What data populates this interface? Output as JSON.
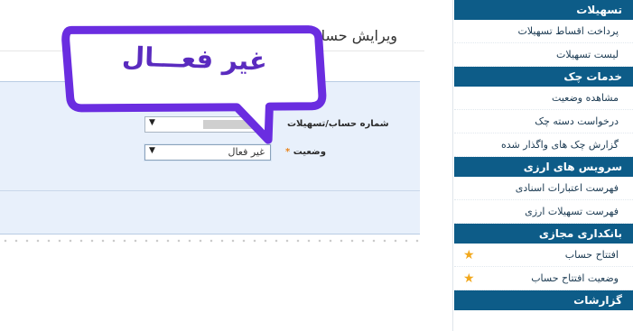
{
  "sidebar": {
    "sections": [
      {
        "header": "تسهیلات",
        "items": [
          {
            "label": "پرداخت اقساط تسهیلات"
          },
          {
            "label": "لیست تسهیلات"
          }
        ]
      },
      {
        "header": "خدمات چک",
        "items": [
          {
            "label": "مشاهده وضعیت"
          },
          {
            "label": "درخواست دسته چک"
          },
          {
            "label": "گزارش چک های واگذار شده"
          }
        ]
      },
      {
        "header": "سرویس های ارزی",
        "items": [
          {
            "label": "فهرست اعتبارات اسنادی"
          },
          {
            "label": "فهرست تسهیلات ارزی"
          }
        ]
      },
      {
        "header": "بانکداری مجازی",
        "items": [
          {
            "label": "افتتاح حساب",
            "starred": true
          },
          {
            "label": "وضعیت افتتاح حساب",
            "starred": true
          }
        ]
      },
      {
        "header": "گزارشات",
        "items": []
      }
    ]
  },
  "main": {
    "title": "ویرایش حسا",
    "form": {
      "label_top_fragment": "ش",
      "account_label": "شماره حساب/تسهیلات",
      "status_label": "وضعیت",
      "status_value": "غیر فعال"
    }
  },
  "callout": {
    "text": "غیر فعـــال"
  },
  "colors": {
    "sidebar_header_bg": "#0d5c88",
    "callout_border": "#6a2de0",
    "star": "#f2a81d",
    "required_star": "#e8841c"
  }
}
